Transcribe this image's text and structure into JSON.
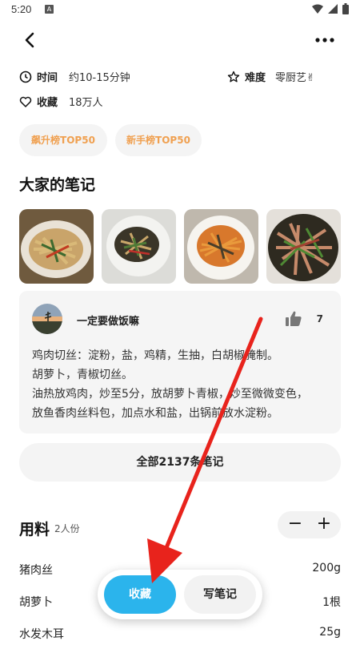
{
  "status_bar": {
    "time": "5:20",
    "notification_icon": "A"
  },
  "recipe_info": {
    "time_label": "时间",
    "time_value": "约10-15分钟",
    "difficulty_label": "难度",
    "difficulty_value": "零厨艺✌",
    "favorites_label": "收藏",
    "favorites_value": "18万人"
  },
  "tags": [
    "飙升榜TOP50",
    "新手榜TOP50"
  ],
  "notes_section": {
    "title": "大家的笔记",
    "photos": [
      "food-photo-1",
      "food-photo-2",
      "food-photo-3",
      "food-photo-4"
    ],
    "featured_note": {
      "author": "一定要做饭嘛",
      "likes": "7",
      "lines": [
        "鸡肉切丝：淀粉，盐，鸡精，生抽，白胡椒腌制。",
        "胡萝卜，青椒切丝。",
        "油热放鸡肉，炒至5分，放胡萝卜青椒，炒至微微变色，",
        "放鱼香肉丝料包，加点水和盐，出锅前放水淀粉。"
      ]
    },
    "all_notes_button": "全部2137条笔记"
  },
  "ingredients": {
    "title": "用料",
    "servings": "2人份",
    "minus": "−",
    "plus": "+",
    "items": [
      {
        "name": "猪肉丝",
        "qty": "200g"
      },
      {
        "name": "胡萝卜",
        "qty": "1根"
      },
      {
        "name": "水发木耳",
        "qty": "25g"
      }
    ]
  },
  "bottom_actions": {
    "favorite": "收藏",
    "write_note": "写笔记"
  },
  "colors": {
    "accent_blue": "#2bb4ec",
    "tag_orange": "#f0a050",
    "annotation_red": "#e8231c"
  }
}
